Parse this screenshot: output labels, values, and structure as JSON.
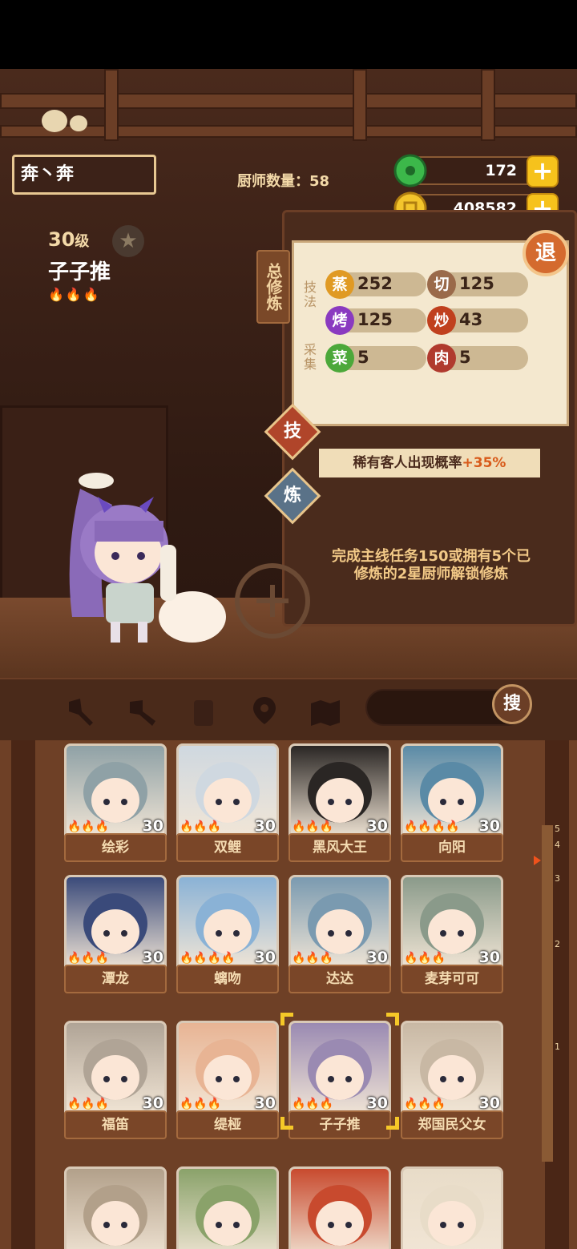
{
  "player": {
    "name": "奔丶奔"
  },
  "header": {
    "chef_count_label": "厨师数量：",
    "chef_count": "58"
  },
  "resources": {
    "jade": "172",
    "coins": "408582"
  },
  "chef": {
    "level": "30",
    "level_unit": "级",
    "name": "子子推",
    "flames": "🔥🔥🔥"
  },
  "panel": {
    "side_tag": "总修炼",
    "retreat_label": "退",
    "skill_section": "技法",
    "gather_section": "采集",
    "stats": [
      {
        "badge": "蒸",
        "value": "252",
        "color": "#e09a24"
      },
      {
        "badge": "切",
        "value": "125",
        "color": "#9a6a4a"
      },
      {
        "badge": "烤",
        "value": "125",
        "color": "#8a3ac0"
      },
      {
        "badge": "炒",
        "value": "43",
        "color": "#c0401e"
      },
      {
        "badge": "菜",
        "value": "5",
        "color": "#4ca83a"
      },
      {
        "badge": "肉",
        "value": "5",
        "color": "#b03a2e"
      }
    ],
    "tab_skill": "技",
    "tab_refine": "炼",
    "bonus_text": "稀有客人出现概率",
    "bonus_pct": "+35%",
    "unlock_line1": "完成主线任务150或拥有5个已",
    "unlock_line2": "修炼的2星厨师解锁修炼"
  },
  "toolbar": {
    "search_label": "搜"
  },
  "colors": {
    "accent": "#f6c21c",
    "flame": "#f06a1a"
  },
  "cards": [
    {
      "name": "绘彩",
      "level": "30",
      "stars": "🔥🔥🔥",
      "bg": "#8fa1a6"
    },
    {
      "name": "双鲤",
      "level": "30",
      "stars": "🔥🔥🔥",
      "bg": "#cfd8e0"
    },
    {
      "name": "黑风大王",
      "level": "30",
      "stars": "🔥🔥🔥",
      "bg": "#2a2624"
    },
    {
      "name": "向阳",
      "level": "30",
      "stars": "🔥🔥🔥🔥",
      "bg": "#5a8aa6"
    },
    {
      "name": "潭龙",
      "level": "30",
      "stars": "🔥🔥🔥",
      "bg": "#3a4a7a"
    },
    {
      "name": "螭吻",
      "level": "30",
      "stars": "🔥🔥🔥🔥",
      "bg": "#8ab2d6"
    },
    {
      "name": "达达",
      "level": "30",
      "stars": "🔥🔥🔥",
      "bg": "#7a9ab0"
    },
    {
      "name": "麦芽可可",
      "level": "30",
      "stars": "🔥🔥🔥",
      "bg": "#8a9a8a"
    },
    {
      "name": "福笛",
      "level": "30",
      "stars": "🔥🔥🔥",
      "bg": "#b0a496"
    },
    {
      "name": "缇桠",
      "level": "30",
      "stars": "🔥🔥🔥",
      "bg": "#e8b494"
    },
    {
      "name": "子子推",
      "level": "30",
      "stars": "🔥🔥🔥",
      "bg": "#9a8ab2"
    },
    {
      "name": "郑国民父女",
      "level": "30",
      "stars": "🔥🔥🔥",
      "bg": "#c8b8a4"
    },
    {
      "name": "",
      "level": "",
      "stars": "",
      "bg": "#b2a08a"
    },
    {
      "name": "",
      "level": "",
      "stars": "",
      "bg": "#8aa26a"
    },
    {
      "name": "",
      "level": "",
      "stars": "",
      "bg": "#c84a2e"
    },
    {
      "name": "",
      "level": "",
      "stars": "",
      "bg": "#e8dcc8"
    }
  ],
  "ruler_marks": [
    "5",
    "4",
    "3",
    "2",
    "1"
  ]
}
